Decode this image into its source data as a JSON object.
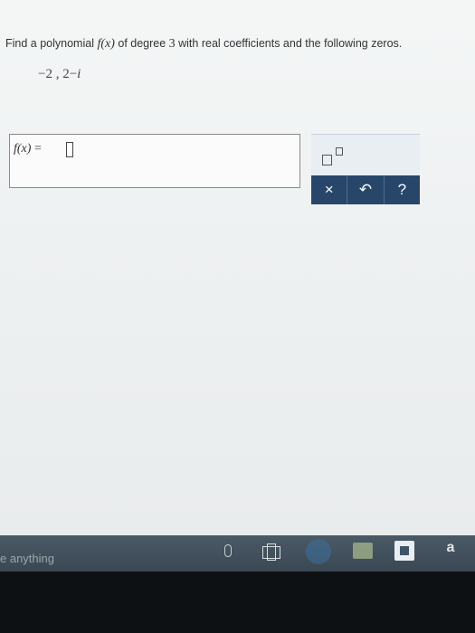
{
  "question": {
    "prefix": "Find a polynomial ",
    "function_name": "f(x)",
    "middle": " of degree ",
    "degree": "3",
    "suffix": " with real coefficients and the following zeros."
  },
  "zeros": {
    "text_real": "−2 , 2−",
    "text_imag": "i"
  },
  "answer": {
    "label_fx": "f(x)",
    "label_eq": " = "
  },
  "palette": {
    "clear_label": "×",
    "undo_label": "↶",
    "help_label": "?"
  },
  "taskbar": {
    "search_text": "e anything",
    "icons": [
      "microphone-icon",
      "task-view-icon",
      "edge-icon",
      "file-explorer-icon",
      "store-icon",
      "amazon-icon"
    ],
    "amazon_label": "a"
  },
  "colors": {
    "palette_bar": "#28466a",
    "taskbar": "#3f4d58"
  }
}
